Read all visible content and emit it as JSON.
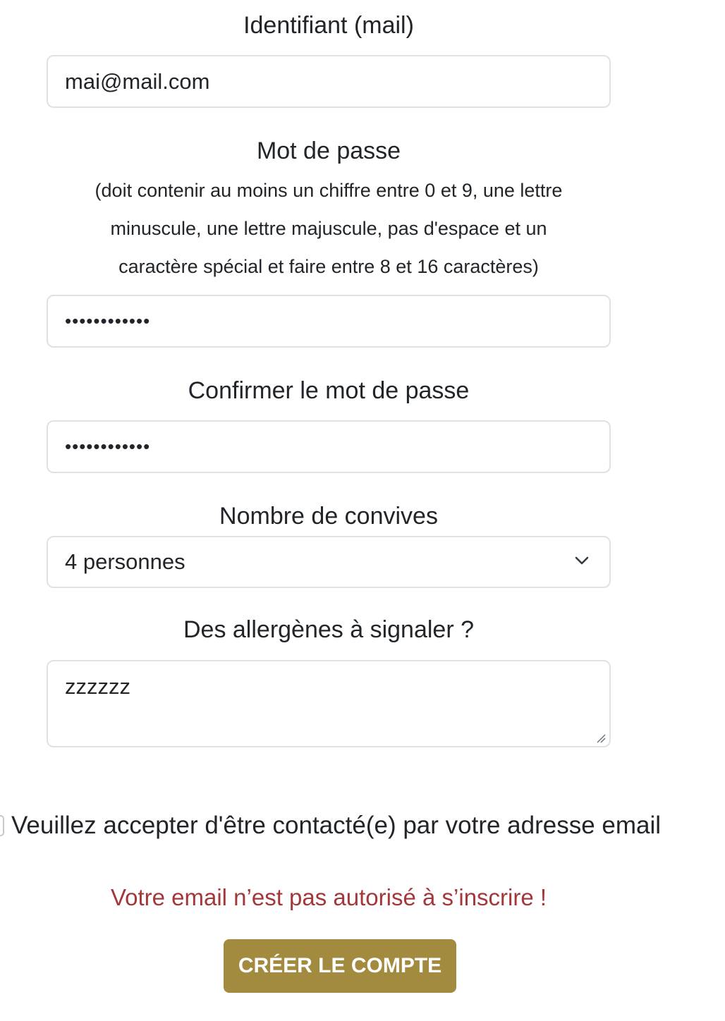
{
  "form": {
    "email_label": "Identifiant (mail)",
    "email_value": "mai@mail.com",
    "password_label": "Mot de passe",
    "password_hint_lines": [
      "(doit contenir au moins un chiffre entre 0 et 9, une lettre",
      "minuscule, une lettre majuscule, pas d'espace et un",
      "caractère spécial et faire entre 8 et 16 caractères)"
    ],
    "password_mask": "••••••••••••",
    "confirm_label": "Confirmer le mot de passe",
    "confirm_mask": "••••••••••••",
    "guests_label": "Nombre de convives",
    "guests_selected": "4 personnes",
    "allergens_label": "Des allergènes à signaler ?",
    "allergens_value": "zzzzzz",
    "consent_label": "Veuillez accepter d'être contacté(e) par votre adresse email",
    "consent_checked": false,
    "error_message": "Votre email n’est pas autorisé à s’inscrire !",
    "submit_label": "Créer le compte"
  },
  "icons": {
    "select": "chevron-down-icon",
    "textarea": "resize-handle-icon"
  },
  "colors": {
    "error": "#a4373a",
    "submit_background": "#a28a3f",
    "submit_text": "#ffffff",
    "field_border": "#dee2e6"
  }
}
